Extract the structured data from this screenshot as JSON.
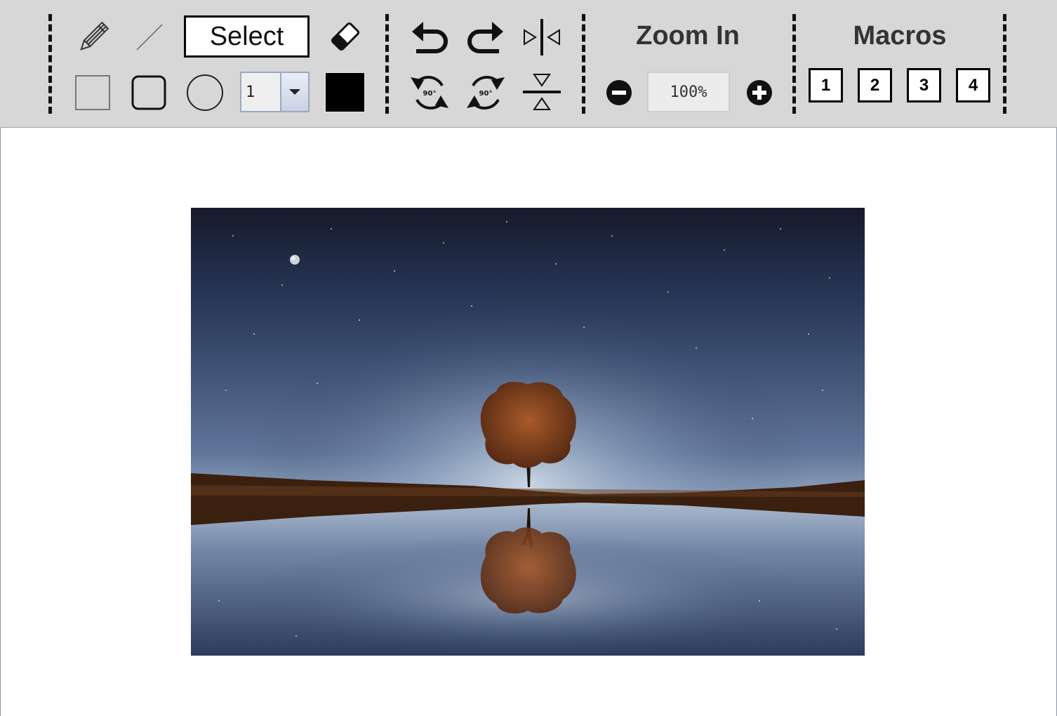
{
  "toolbar": {
    "select_label": "Select",
    "line_width_value": "1",
    "color_value": "#000000",
    "zoom_title": "Zoom In",
    "zoom_value": "100%",
    "macros_title": "Macros",
    "macros": [
      "1",
      "2",
      "3",
      "4"
    ],
    "rotate_ccw_label": "90°",
    "rotate_cw_label": "90°",
    "icons": {
      "pencil": "pencil-icon",
      "line": "line-icon",
      "eraser": "eraser-icon",
      "rect": "rectangle-icon",
      "rounded_rect": "rounded-rectangle-icon",
      "ellipse": "ellipse-icon",
      "undo": "undo-icon",
      "redo": "redo-icon",
      "flip_h": "flip-horizontal-icon",
      "rotate_ccw": "rotate-ccw-icon",
      "rotate_cw": "rotate-cw-icon",
      "flip_v": "flip-vertical-icon",
      "zoom_out": "zoom-out-icon",
      "zoom_in": "zoom-in-icon"
    }
  },
  "canvas": {
    "background": "#ffffff",
    "image_subject": "night-sky-tree-reflection"
  }
}
